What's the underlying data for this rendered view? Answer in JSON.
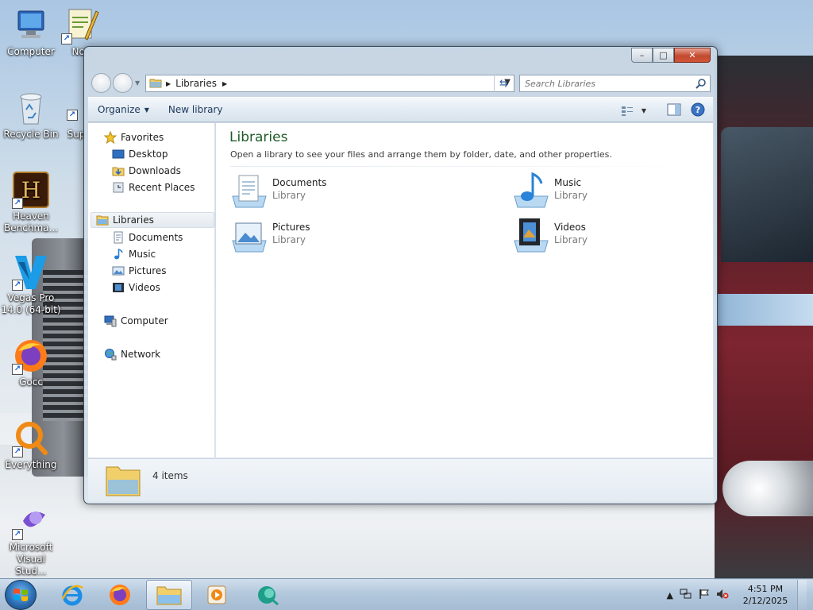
{
  "desktop": {
    "icons": [
      {
        "label": "Computer",
        "icon": "computer-icon"
      },
      {
        "label": "Not",
        "icon": "notepad-plus-icon"
      },
      {
        "label": "Recycle Bin",
        "icon": "recycle-bin-icon"
      },
      {
        "label": "Sup",
        "icon": "shortcut-icon"
      },
      {
        "label": "Heaven\nBenchma...",
        "icon": "heaven-benchmark-icon"
      },
      {
        "label": "Vegas Pro\n14.0 (64-bit)",
        "icon": "vegas-pro-icon"
      },
      {
        "label": "Gocc",
        "icon": "firefox-icon"
      },
      {
        "label": "Everything",
        "icon": "everything-icon"
      },
      {
        "label": "Microsoft\nVisual Stud...",
        "icon": "visual-studio-icon"
      }
    ]
  },
  "window": {
    "address": {
      "path": "Libraries"
    },
    "search": {
      "placeholder": "Search Libraries"
    },
    "caption": {
      "minimize": "–",
      "maximize": "□",
      "close": "✕"
    },
    "toolbar": {
      "organize": "Organize",
      "new_library": "New library"
    },
    "nav": {
      "favorites": {
        "label": "Favorites",
        "items": [
          "Desktop",
          "Downloads",
          "Recent Places"
        ]
      },
      "libraries": {
        "label": "Libraries",
        "items": [
          "Documents",
          "Music",
          "Pictures",
          "Videos"
        ]
      },
      "computer": "Computer",
      "network": "Network"
    },
    "content": {
      "title": "Libraries",
      "description": "Open a library to see your files and arrange them by folder, date, and other properties.",
      "libraries": [
        {
          "name": "Documents",
          "type": "Library",
          "icon": "documents-library-icon"
        },
        {
          "name": "Music",
          "type": "Library",
          "icon": "music-library-icon"
        },
        {
          "name": "Pictures",
          "type": "Library",
          "icon": "pictures-library-icon"
        },
        {
          "name": "Videos",
          "type": "Library",
          "icon": "videos-library-icon"
        }
      ]
    },
    "details": {
      "count": "4 items"
    }
  },
  "taskbar": {
    "pinned": [
      "internet-explorer-icon",
      "firefox-icon",
      "file-explorer-icon",
      "media-player-icon",
      "app-icon"
    ],
    "clock": {
      "time": "4:51 PM",
      "date": "2/12/2025"
    }
  },
  "colors": {
    "accent": "#1e5c26",
    "link": "#1e395b",
    "close": "#c24a2e"
  }
}
